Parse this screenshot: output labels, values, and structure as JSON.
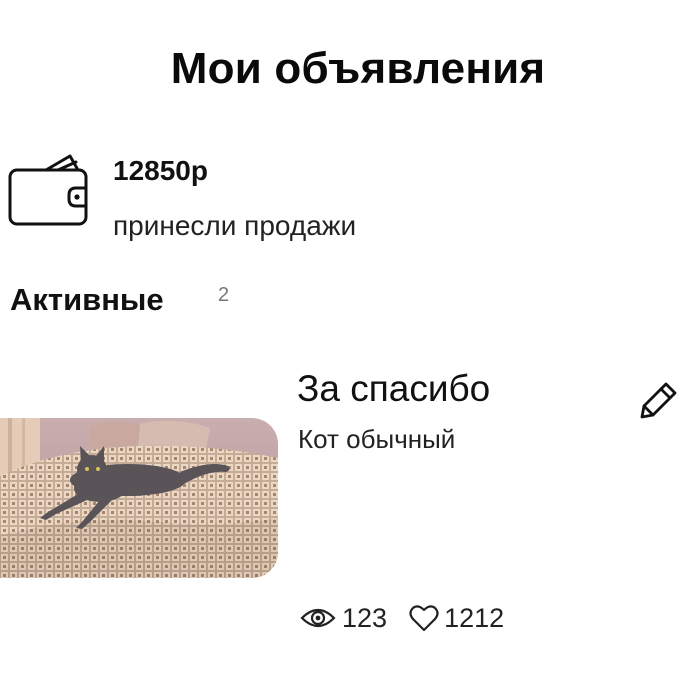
{
  "header": {
    "title": "Мои объявления"
  },
  "sales": {
    "icon": "wallet-icon",
    "amount": "12850р",
    "caption": "принесли продажи"
  },
  "section": {
    "title": "Активные",
    "count": "2"
  },
  "listing": {
    "title": "За спасибо",
    "subtitle": "Кот обычный",
    "photo_icon": "cat-photo",
    "edit_icon": "pencil-icon",
    "views_icon": "eye-icon",
    "views": "123",
    "likes_icon": "heart-icon",
    "likes": "1212"
  }
}
